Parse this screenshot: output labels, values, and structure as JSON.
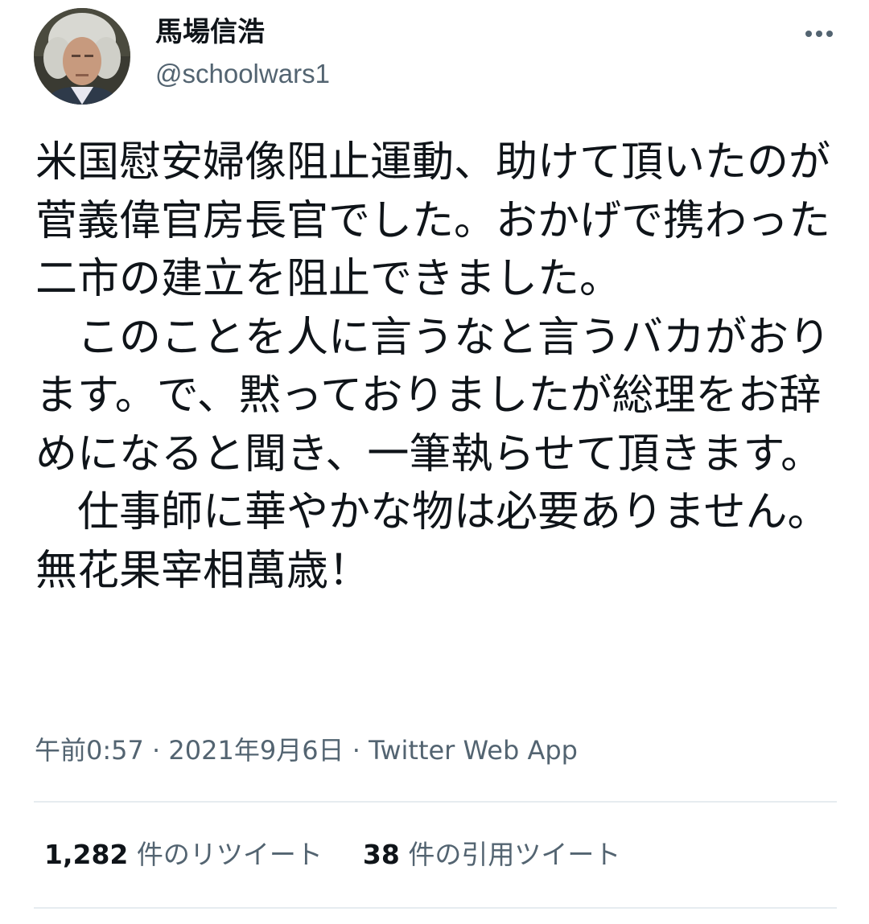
{
  "author": {
    "display_name": "馬場信浩",
    "handle": "@schoolwars1",
    "avatar_icon": "profile-photo"
  },
  "menu": {
    "icon": "more-horizontal-icon",
    "glyph": "•••"
  },
  "tweet": {
    "text": "米国慰安婦像阻止運動、助けて頂いたのが菅義偉官房長官でした。おかげで携わった二市の建立を阻止できました。\n　このことを人に言うなと言うバカがおります。で、黙っておりましたが総理をお辞めになると聞き、一筆執らせて頂きます。\n　仕事師に華やかな物は必要ありません。無花果宰相萬歳！"
  },
  "meta": {
    "time": "午前0:57",
    "date": "2021年9月6日",
    "source": "Twitter Web App",
    "separator": " · "
  },
  "stats": {
    "retweets_count": "1,282",
    "retweets_label": "件のリツイート",
    "quotes_count": "38",
    "quotes_label": "件の引用ツイート"
  },
  "colors": {
    "primary_text": "#0f1419",
    "secondary_text": "#536471",
    "divider": "#e6ecf0"
  }
}
